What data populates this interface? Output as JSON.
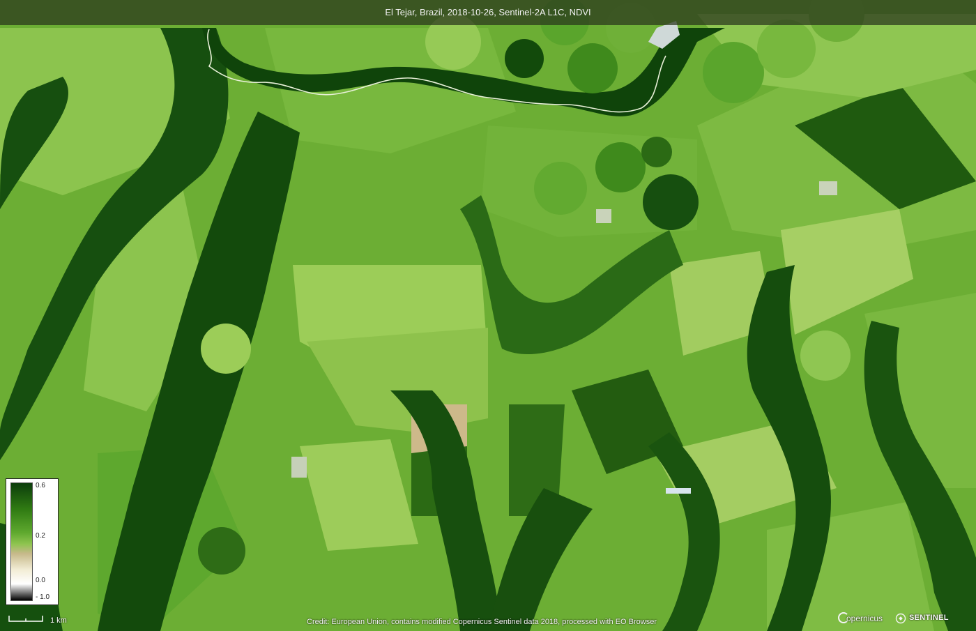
{
  "map": {
    "title": "El Tejar, Brazil, 2018-10-26, Sentinel-2A L1C, NDVI",
    "legend": {
      "ticks": [
        "0.6",
        "0.2",
        "0.0",
        "- 1.0"
      ],
      "colors": [
        "#0c3d0c",
        "#2f7a12",
        "#5ea82e",
        "#8fc450",
        "#c6b98a",
        "#f2edd6",
        "#ffffff",
        "#000000"
      ]
    },
    "scale_label": "1 km",
    "credit": "Credit: European Union, contains modified Copernicus Sentinel data 2018, processed with EO Browser",
    "logos": {
      "copernicus": "opernicus",
      "sentinel": "SENTINEL"
    },
    "palette": {
      "dark_river": "#0f4a0c",
      "dark_field": "#2c6a14",
      "mid_field": "#5aa52c",
      "light_field": "#8cc44e",
      "pale_field": "#b4d27a",
      "bare_soil": "#cfd7a0"
    }
  }
}
